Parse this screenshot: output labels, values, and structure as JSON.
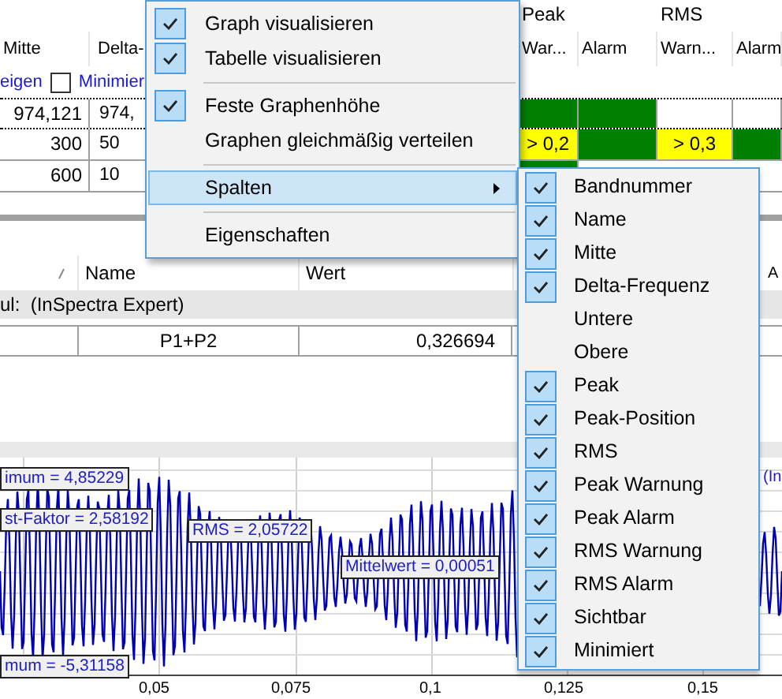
{
  "band_table": {
    "group_headers": [
      {
        "label": "Peak"
      },
      {
        "label": "RMS"
      }
    ],
    "columns": [
      "Mitte",
      "Delta-",
      "War...",
      "Alarm",
      "Warn...",
      "Alarm"
    ],
    "filter_row": {
      "link": "eigen",
      "checkbox": {
        "label": "Minimier",
        "checked": false
      }
    },
    "rows": [
      {
        "focused": true,
        "cells": [
          {
            "text": "974,121"
          },
          {
            "text": "974,"
          },
          {
            "text": "",
            "color": "#008000"
          },
          {
            "text": "",
            "color": "#008000"
          },
          {
            "text": "",
            "color": "#ffffff"
          },
          {
            "text": "",
            "color": "#ffffff"
          }
        ]
      },
      {
        "focused": false,
        "cells": [
          {
            "text": "300"
          },
          {
            "text": "50"
          },
          {
            "text": "> 0,2",
            "color": "#ffff00"
          },
          {
            "text": "",
            "color": "#008000"
          },
          {
            "text": "> 0,3",
            "color": "#ffff00"
          },
          {
            "text": "",
            "color": "#008000"
          }
        ]
      },
      {
        "focused": false,
        "cells": [
          {
            "text": "600"
          },
          {
            "text": "10"
          },
          {
            "text": "",
            "color": "#008000"
          }
        ]
      }
    ]
  },
  "result_table": {
    "columns": [
      "Name",
      "Wert"
    ],
    "column_3": "A",
    "group": "ul:  (InSpectra Expert)",
    "rows": [
      {
        "name": "P1+P2",
        "wert": "0,326694"
      }
    ]
  },
  "chart": {
    "annotations": [
      "imum = 4,85229",
      "st-Faktor = 2,58192",
      "RMS = 2,05722",
      "Mittelwert = 0,00051",
      "mum = -5,31158"
    ],
    "legend_fragment": "(In",
    "x_labels": [
      "0,05",
      "0,075",
      "0,1",
      "0,125",
      "0,15"
    ]
  },
  "menu": {
    "items": [
      {
        "kind": "item",
        "label": "Graph visualisieren",
        "checked": true,
        "selected": false
      },
      {
        "kind": "item",
        "label": "Tabelle visualisieren",
        "checked": true,
        "selected": false
      },
      {
        "kind": "separator"
      },
      {
        "kind": "item",
        "label": "Feste Graphenhöhe",
        "checked": true,
        "selected": false
      },
      {
        "kind": "item",
        "label": "Graphen gleichmäßig verteilen",
        "checked": false,
        "selected": false
      },
      {
        "kind": "separator"
      },
      {
        "kind": "submenu",
        "label": "Spalten",
        "checked": false,
        "selected": true
      },
      {
        "kind": "separator"
      },
      {
        "kind": "item",
        "label": "Eigenschaften",
        "checked": false,
        "selected": false
      }
    ]
  },
  "submenu": {
    "items": [
      {
        "label": "Bandnummer",
        "checked": true
      },
      {
        "label": "Name",
        "checked": true
      },
      {
        "label": "Mitte",
        "checked": true
      },
      {
        "label": "Delta-Frequenz",
        "checked": true
      },
      {
        "label": "Untere",
        "checked": false
      },
      {
        "label": "Obere",
        "checked": false
      },
      {
        "label": "Peak",
        "checked": true
      },
      {
        "label": "Peak-Position",
        "checked": true
      },
      {
        "label": "RMS",
        "checked": true
      },
      {
        "label": "Peak Warnung",
        "checked": true
      },
      {
        "label": "Peak Alarm",
        "checked": true
      },
      {
        "label": "RMS Warnung",
        "checked": true
      },
      {
        "label": "RMS Alarm",
        "checked": true
      },
      {
        "label": "Sichtbar",
        "checked": true
      },
      {
        "label": "Minimiert",
        "checked": true
      }
    ]
  }
}
